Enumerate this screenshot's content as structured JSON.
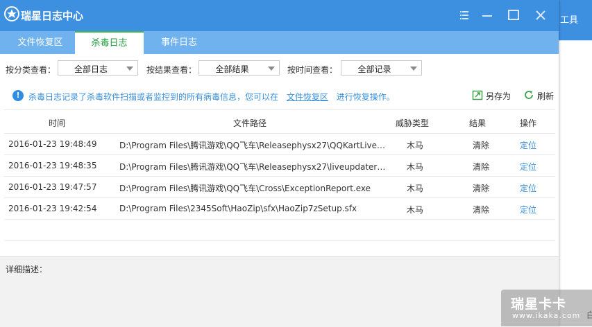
{
  "window": {
    "title": "瑞星日志中心",
    "controls": [
      "menu-icon",
      "minimize-icon",
      "maximize-icon",
      "close-icon"
    ]
  },
  "tabs": [
    {
      "label": "文件恢复区",
      "active": false
    },
    {
      "label": "杀毒日志",
      "active": true
    },
    {
      "label": "事件日志",
      "active": false
    }
  ],
  "filters": {
    "category_label": "按分类查看：",
    "category_value": "全部日志",
    "result_label": "按结果查看：",
    "result_value": "全部结果",
    "time_label": "按时间查看：",
    "time_value": "全部记录"
  },
  "info": {
    "text_before": "杀毒日志记录了杀毒软件扫描或者监控到的所有病毒信息，您可以在",
    "link": "文件恢复区",
    "text_after": "进行恢复操作。",
    "save_as": "另存为",
    "refresh": "刷新"
  },
  "table": {
    "headers": {
      "time": "时间",
      "path": "文件路径",
      "type": "威胁类型",
      "result": "结果",
      "op": "操作"
    },
    "rows": [
      {
        "time": "2016-01-23 19:48:49",
        "path": "D:\\Program Files\\腾讯游戏\\QQ飞车\\Releasephysx27\\QQKartLiveU...",
        "type": "木马",
        "result": "清除",
        "op": "定位"
      },
      {
        "time": "2016-01-23 19:48:35",
        "path": "D:\\Program Files\\腾讯游戏\\QQ飞车\\Releasephysx27\\liveupdater\\T...",
        "type": "木马",
        "result": "清除",
        "op": "定位"
      },
      {
        "time": "2016-01-23 19:47:57",
        "path": "D:\\Program Files\\腾讯游戏\\QQ飞车\\Cross\\ExceptionReport.exe",
        "type": "木马",
        "result": "清除",
        "op": "定位"
      },
      {
        "time": "2016-01-23 19:42:54",
        "path": "D:\\Program Files\\2345Soft\\HaoZip\\sfx\\HaoZip7zSetup.sfx",
        "type": "木马",
        "result": "清除",
        "op": "定位"
      }
    ]
  },
  "detail": {
    "label": "详细描述："
  },
  "background": {
    "tools_label": "工具",
    "bottom_char": "白"
  },
  "watermark": {
    "brand": "瑞星卡卡",
    "url": "www.ikaka.com"
  },
  "colors": {
    "titlebar": "#3d8fe0",
    "tabbar": "#6fb2ee",
    "active_tab_text": "#1e9b3a",
    "link": "#3a8fd9"
  }
}
